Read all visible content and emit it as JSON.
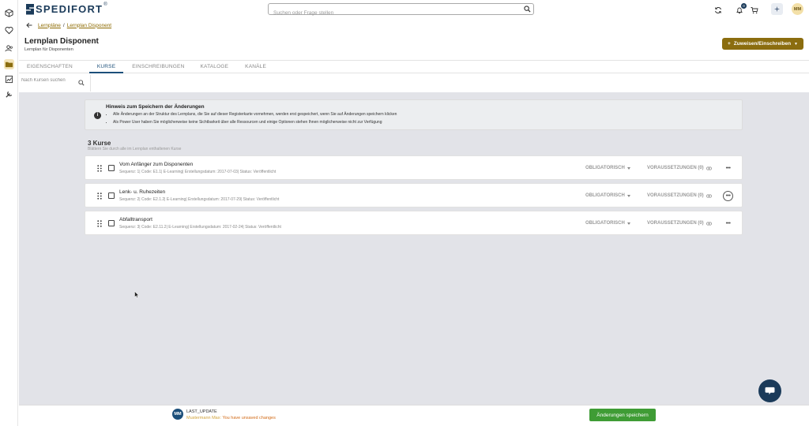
{
  "app": {
    "brand": "SPEDIFORT",
    "brand_reg": "®"
  },
  "header": {
    "search_placeholder": "Suchen oder Frage stellen",
    "notification_count": "0",
    "user_initials": "MM"
  },
  "rail": {
    "icons": [
      "cube-icon",
      "heart-icon",
      "users-icon",
      "folder-icon",
      "chart-icon",
      "tools-icon"
    ]
  },
  "breadcrumb": {
    "items": [
      "Lernpläne",
      "Lernplan Disponent"
    ],
    "separator": "/"
  },
  "page": {
    "title": "Lernplan Disponent",
    "subtitle": "Lernplan für Disponenten",
    "assign_button": "Zuweisen/Einschreiben"
  },
  "tabs": [
    {
      "label": "EIGENSCHAFTEN",
      "active": false
    },
    {
      "label": "KURSE",
      "active": true
    },
    {
      "label": "EINSCHREIBUNGEN",
      "active": false
    },
    {
      "label": "KATALOGE",
      "active": false
    },
    {
      "label": "KANÄLE",
      "active": false
    }
  ],
  "course_search": {
    "placeholder": "Nach Kursen suchen"
  },
  "notice": {
    "title": "Hinweis zum Speichern der Änderungen",
    "bullets": [
      "Alle Änderungen an der Struktur des Lernplans, die Sie auf dieser Registerkarte vornehmen, werden erst gespeichert, wenn Sie auf Änderungen speichern klicken",
      "Als Power User haben Sie möglicherweise keine Sichtbarkeit über alle Ressourcen und einige Optionen stehen Ihnen möglicherweise nicht zur Verfügung"
    ]
  },
  "courses": {
    "count_label": "3 Kurse",
    "count_sub": "Blättern Sie durch alle im Lernplan enthaltenen Kurse",
    "items": [
      {
        "title": "Vom Anfänger zum Disponenten",
        "meta": "Sequenz: 1| Code: E1.1| E-Learning| Erstellungsdatum: 2017-07-03| Status: Veröffentlicht",
        "mandatory": "OBLIGATORISCH",
        "prereq": "VORAUSSETZUNGEN (0)"
      },
      {
        "title": "Lenk- u. Ruhezeiten",
        "meta": "Sequenz: 2| Code: E2.1.2| E-Learning| Erstellungsdatum: 2017-07-29| Status: Veröffentlicht",
        "mandatory": "OBLIGATORISCH",
        "prereq": "VORAUSSETZUNGEN (0)"
      },
      {
        "title": "Abfalltransport",
        "meta": "Sequenz: 3| Code: E2.11.2| E-Learning| Erstellungsdatum: 2017-02-24| Status: Veröffentlicht",
        "mandatory": "OBLIGATORISCH",
        "prereq": "VORAUSSETZUNGEN (0)"
      }
    ]
  },
  "footer": {
    "avatar_initials": "MM",
    "last_update": "LAST_UPDATE",
    "user": "Mustermann Max:",
    "unsaved": "You have unsaved changes",
    "save_button": "Änderungen speichern"
  },
  "colors": {
    "brand": "#1b3b5a",
    "accent_gold": "#8b6d0f",
    "tab_active": "#1c4f7a",
    "save_green": "#3f9c35",
    "warning_orange": "#d26a16"
  }
}
